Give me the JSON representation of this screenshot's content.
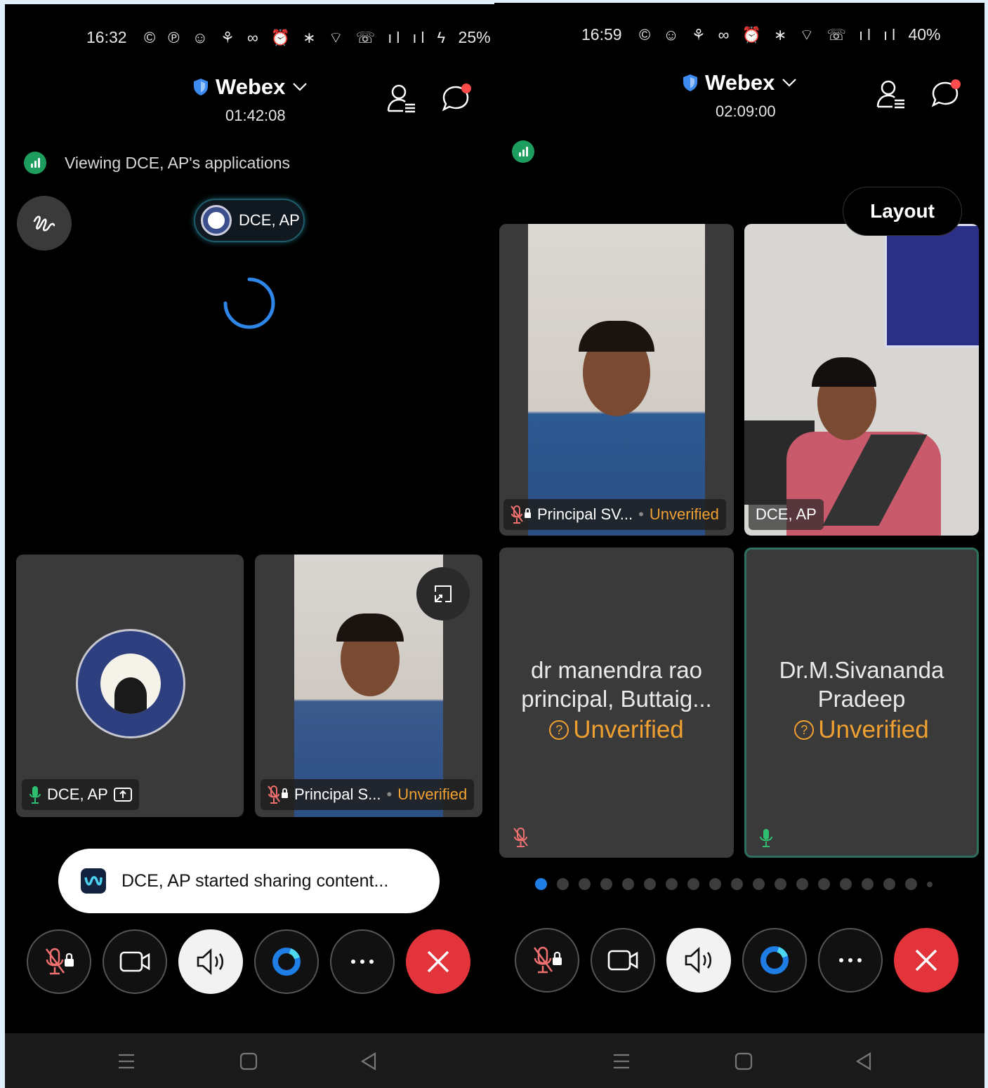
{
  "left": {
    "status": {
      "time": "16:32",
      "icons": "© ℗ ☺ ⚘ ∞ ⏰ ∗ ⌔ ☏ ıl ıl ϟ",
      "battery": "25%"
    },
    "header": {
      "app": "Webex",
      "timer": "01:42:08"
    },
    "viewing_text": "Viewing DCE, AP's applications",
    "presenter_chip": "DCE, AP",
    "tiles": [
      {
        "name": "DCE, AP"
      },
      {
        "name": "Principal S...",
        "badge": "Unverified"
      }
    ],
    "toast": "DCE, AP started sharing content..."
  },
  "right": {
    "status": {
      "time": "16:59",
      "icons": "© ☺ ⚘ ∞ ⏰ ∗ ⌔ ☏ ıl ıl",
      "battery": "40%"
    },
    "header": {
      "app": "Webex",
      "timer": "02:09:00"
    },
    "layout_button": "Layout",
    "tiles": [
      {
        "name": "Principal SV...",
        "badge": "Unverified"
      },
      {
        "name": "DCE, AP"
      },
      {
        "line1": "dr manendra rao",
        "line2": "principal, Buttaig...",
        "badge": "Unverified"
      },
      {
        "line1": "Dr.M.Sivananda",
        "line2": "Pradeep",
        "badge": "Unverified"
      }
    ],
    "page_dots": 19,
    "active_dot": 0
  },
  "controls": [
    "mute-button",
    "video-button",
    "speaker-button",
    "share-button",
    "more-button",
    "leave-button"
  ],
  "colors": {
    "accent": "#1f7de6",
    "leave": "#e2343a",
    "unverified": "#f0a030",
    "signal": "#1e9e5e"
  }
}
